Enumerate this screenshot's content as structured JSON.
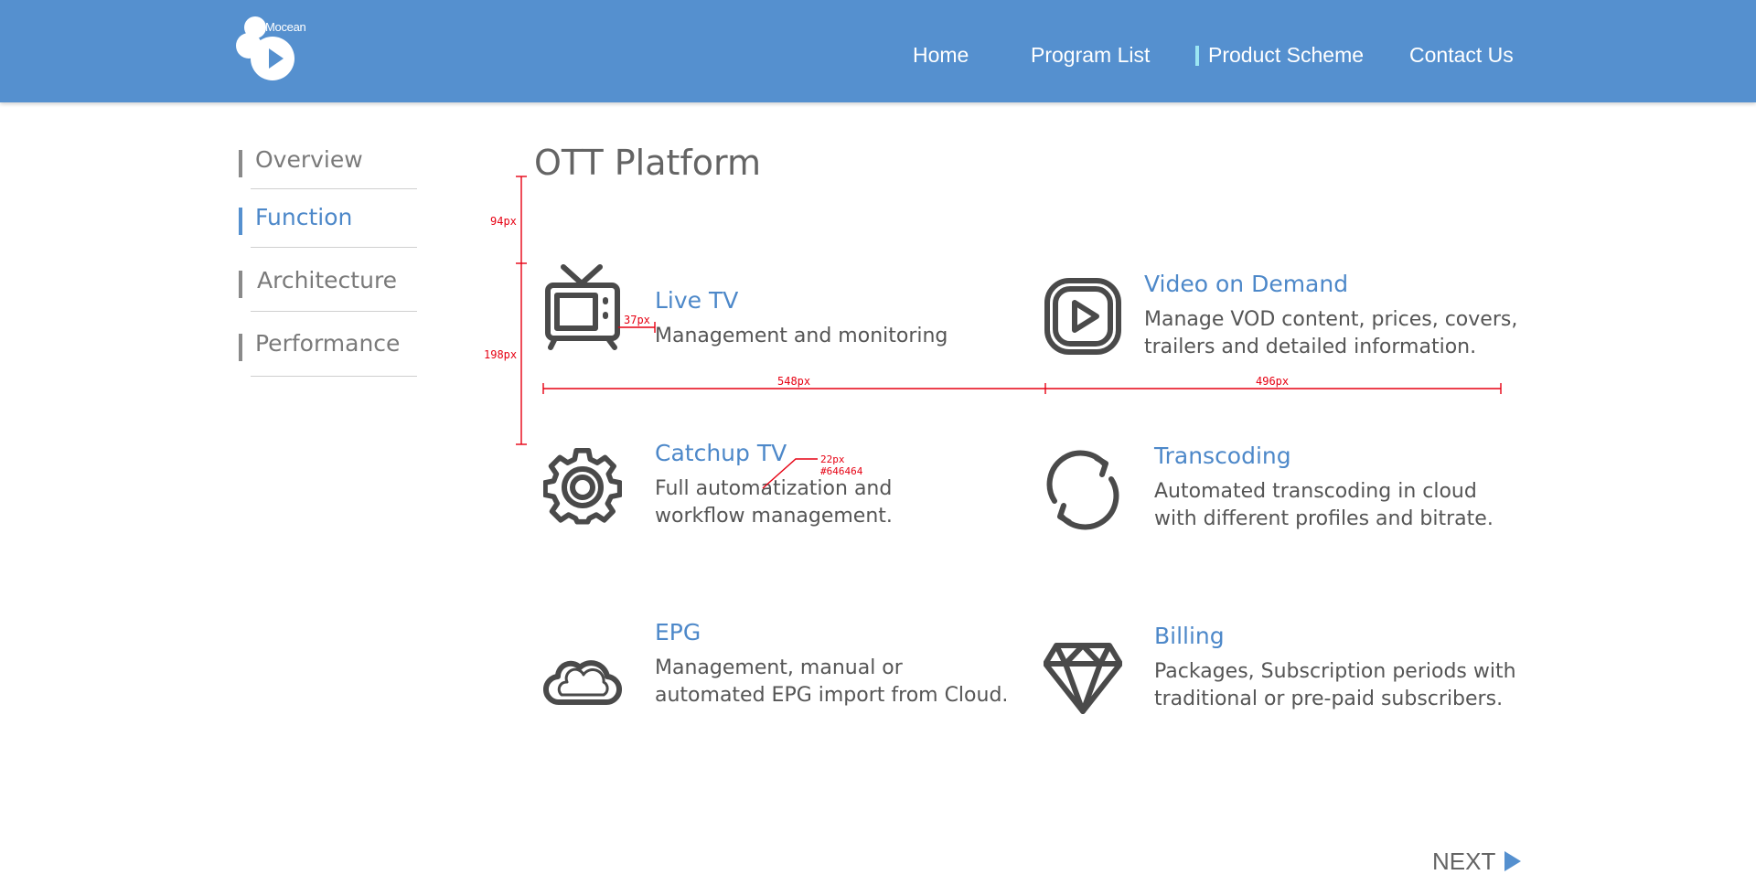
{
  "header": {
    "logo_text": "Mocean",
    "nav": [
      "Home",
      "Program List",
      "Product Scheme",
      "Contact Us"
    ],
    "active_nav": "Product Scheme"
  },
  "sidebar": {
    "items": [
      {
        "label": "Overview",
        "active": false
      },
      {
        "label": "Function",
        "active": true
      },
      {
        "label": "Architecture",
        "active": false
      },
      {
        "label": "Performance",
        "active": false
      }
    ]
  },
  "main": {
    "title": "OTT Platform",
    "features": [
      {
        "icon": "tv-icon",
        "title": "Live TV",
        "desc": [
          "Management and monitoring"
        ]
      },
      {
        "icon": "play-icon",
        "title": "Video on Demand",
        "desc": [
          "Manage VOD content, prices, covers,",
          "trailers and detailed information."
        ]
      },
      {
        "icon": "gear-icon",
        "title": "Catchup TV",
        "desc": [
          "Full automatization and",
          "workflow management."
        ]
      },
      {
        "icon": "refresh-icon",
        "title": "Transcoding",
        "desc": [
          "Automated transcoding in cloud",
          "with different profiles and bitrate."
        ]
      },
      {
        "icon": "cloud-icon",
        "title": "EPG",
        "desc": [
          "Management, manual or",
          "automated EPG import from Cloud."
        ]
      },
      {
        "icon": "diamond-icon",
        "title": "Billing",
        "desc": [
          "Packages, Subscription periods with",
          "traditional or pre-paid subscribers."
        ]
      }
    ]
  },
  "annotations": {
    "a1": "94px",
    "a2": "198px",
    "a3": "37px",
    "a4": "548px",
    "a5": "496px",
    "a6": "22px",
    "a7": "#646464"
  },
  "next": {
    "label": "NEXT"
  },
  "colors": {
    "header": "#5590cf",
    "accent": "#4d88c9",
    "text": "#646464",
    "annotation": "#e60012"
  }
}
